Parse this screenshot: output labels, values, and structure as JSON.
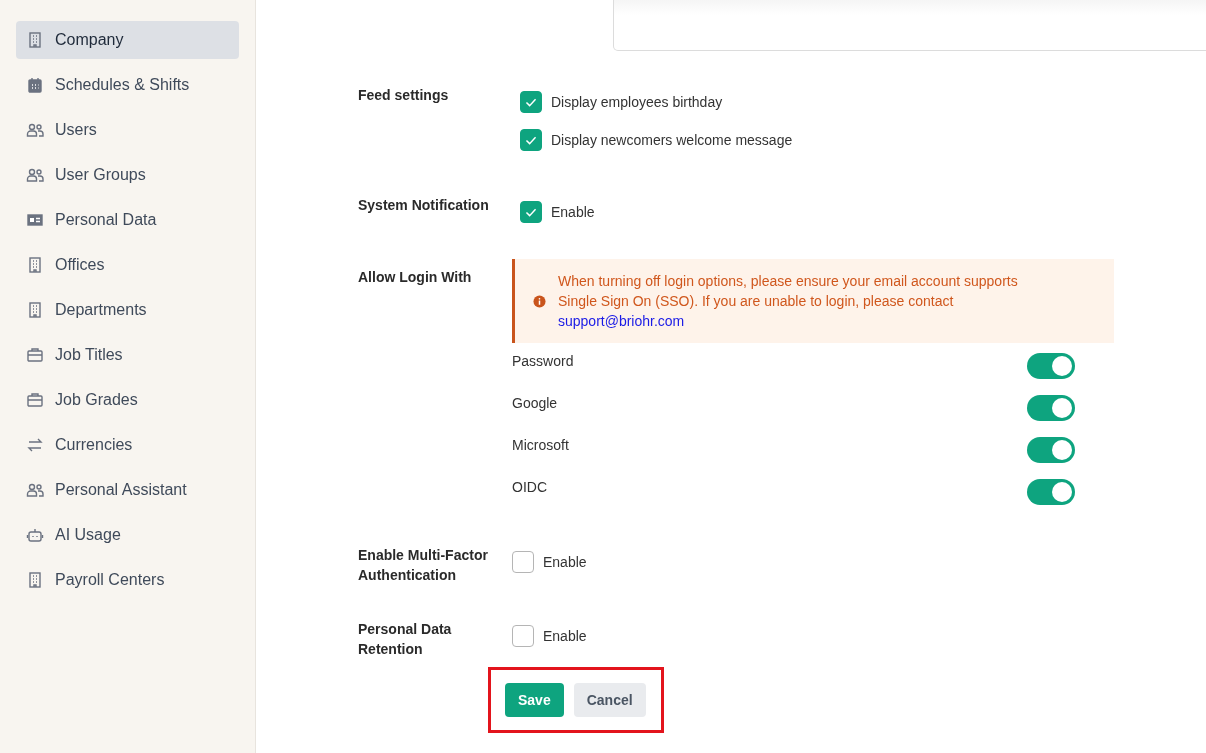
{
  "sidebar": {
    "items": [
      {
        "label": "Company",
        "kind": "building",
        "selected": true
      },
      {
        "label": "Schedules & Shifts",
        "kind": "calendar",
        "selected": false
      },
      {
        "label": "Users",
        "kind": "users",
        "selected": false
      },
      {
        "label": "User Groups",
        "kind": "users",
        "selected": false
      },
      {
        "label": "Personal Data",
        "kind": "idcard",
        "selected": false
      },
      {
        "label": "Offices",
        "kind": "building",
        "selected": false
      },
      {
        "label": "Departments",
        "kind": "building",
        "selected": false
      },
      {
        "label": "Job Titles",
        "kind": "briefcase",
        "selected": false
      },
      {
        "label": "Job Grades",
        "kind": "briefcase",
        "selected": false
      },
      {
        "label": "Currencies",
        "kind": "arrows",
        "selected": false
      },
      {
        "label": "Personal Assistant",
        "kind": "users",
        "selected": false
      },
      {
        "label": "AI Usage",
        "kind": "robot",
        "selected": false
      },
      {
        "label": "Payroll Centers",
        "kind": "building",
        "selected": false
      }
    ]
  },
  "settings": [
    {
      "kind": "checkboxes",
      "label": "Feed settings",
      "options": [
        {
          "label": "Display employees birthday",
          "checked": true
        },
        {
          "label": "Display newcomers welcome message",
          "checked": true
        }
      ]
    },
    {
      "kind": "checkboxes",
      "label": "System Notification",
      "options": [
        {
          "label": "Enable",
          "checked": true
        }
      ]
    },
    {
      "kind": "toggles",
      "label": "Allow Login With",
      "alert": {
        "text": "When turning off login options, please ensure your email account supports Single Sign On (SSO). If you are unable to login, please contact",
        "link": "support@briohr.com"
      },
      "options": [
        {
          "label": "Password",
          "on": true
        },
        {
          "label": "Google",
          "on": true
        },
        {
          "label": "Microsoft",
          "on": true
        },
        {
          "label": "OIDC",
          "on": true
        }
      ]
    },
    {
      "kind": "checkboxes",
      "label": "Enable Multi-Factor Authentication",
      "options": [
        {
          "label": "Enable",
          "checked": false
        }
      ]
    },
    {
      "kind": "checkboxes",
      "label": "Personal Data Retention",
      "options": [
        {
          "label": "Enable",
          "checked": false
        }
      ]
    }
  ],
  "buttons": {
    "highlighted": true,
    "save": "Save",
    "cancel": "Cancel"
  }
}
